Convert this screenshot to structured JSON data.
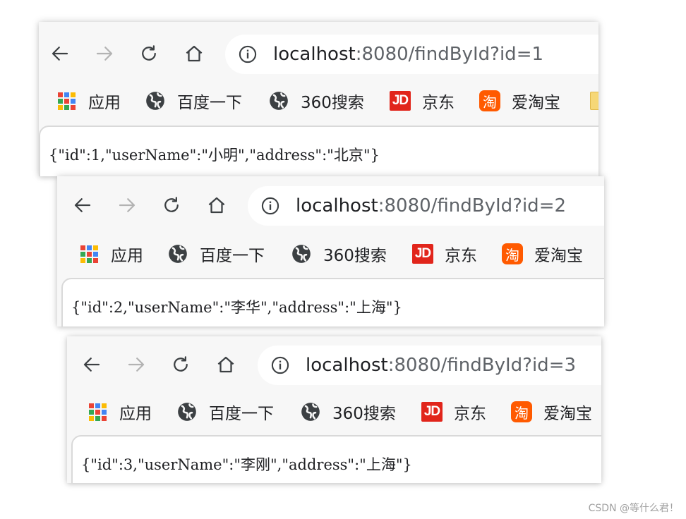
{
  "windows": [
    {
      "url_host": "localhost",
      "url_rest": ":8080/findById?id=1",
      "bookmarks": [
        "应用",
        "百度一下",
        "360搜索",
        "京东",
        "爱淘宝"
      ],
      "response": "{\"id\":1,\"userName\":\"小明\",\"address\":\"北京\"}"
    },
    {
      "url_host": "localhost",
      "url_rest": ":8080/findById?id=2",
      "bookmarks": [
        "应用",
        "百度一下",
        "360搜索",
        "京东",
        "爱淘宝"
      ],
      "response": "{\"id\":2,\"userName\":\"李华\",\"address\":\"上海\"}"
    },
    {
      "url_host": "localhost",
      "url_rest": ":8080/findById?id=3",
      "bookmarks": [
        "应用",
        "百度一下",
        "360搜索",
        "京东",
        "爱淘宝"
      ],
      "response": "{\"id\":3,\"userName\":\"李刚\",\"address\":\"上海\"}"
    }
  ],
  "icons": {
    "back": "back-arrow-icon",
    "forward": "forward-arrow-icon",
    "reload": "reload-icon",
    "home": "home-icon",
    "info": "info-icon",
    "apps": "apps-grid-icon",
    "baidu": "globe-icon",
    "so360": "globe-icon",
    "jd": "jd-logo-icon",
    "taobao": "taobao-logo-icon"
  },
  "jd_logo_text": "JD",
  "taobao_logo_text": "淘",
  "colors": {
    "toolbar_bg": "#f7f7f7",
    "omnibox_bg": "#ffffff",
    "icon_active": "#3c4043",
    "icon_disabled": "#b3b3b3",
    "jd_red": "#e1251b",
    "taobao_orange": "#ff5a00"
  },
  "watermark": "CSDN @等什么君！"
}
